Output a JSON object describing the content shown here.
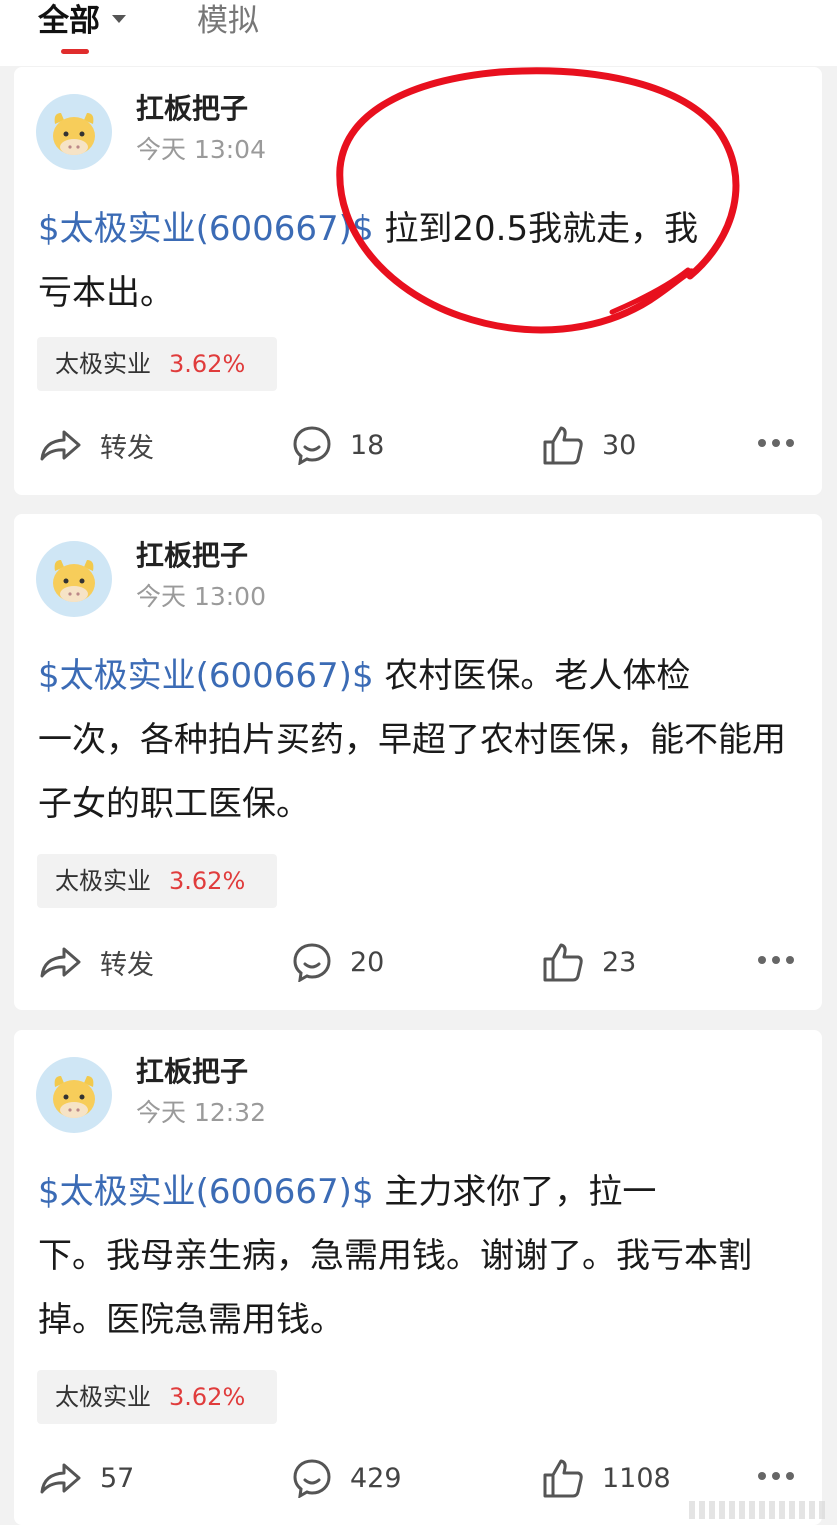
{
  "topbar": {
    "tab_all": "全部",
    "tab_sim": "模拟"
  },
  "colors": {
    "accent_red": "#e02d2d",
    "link_blue": "#3b6bb5",
    "pct_red": "#e03c3c",
    "annotation_red": "#e8101e"
  },
  "posts": [
    {
      "author": "扛板把子",
      "time": "今天 13:04",
      "stock_link": "$太极实业(600667)$",
      "text_line1": " 拉到20.5我就走，我",
      "text_rest": "亏本出。",
      "tag_name": "太极实业",
      "tag_pct": "3.62%",
      "action1": "转发",
      "comments": "18",
      "likes": "30"
    },
    {
      "author": "扛板把子",
      "time": "今天 13:00",
      "stock_link": "$太极实业(600667)$",
      "text_line1": " 农村医保。老人体检",
      "text_rest": "一次，各种拍片买药，早超了农村医保，能不能用子女的职工医保。",
      "tag_name": "太极实业",
      "tag_pct": "3.62%",
      "action1": "转发",
      "comments": "20",
      "likes": "23"
    },
    {
      "author": "扛板把子",
      "time": "今天 12:32",
      "stock_link": "$太极实业(600667)$",
      "text_line1": " 主力求你了，拉一",
      "text_rest": "下。我母亲生病，急需用钱。谢谢了。我亏本割掉。医院急需用钱。",
      "tag_name": "太极实业",
      "tag_pct": "3.62%",
      "action1": "57",
      "comments": "429",
      "likes": "1108"
    }
  ]
}
